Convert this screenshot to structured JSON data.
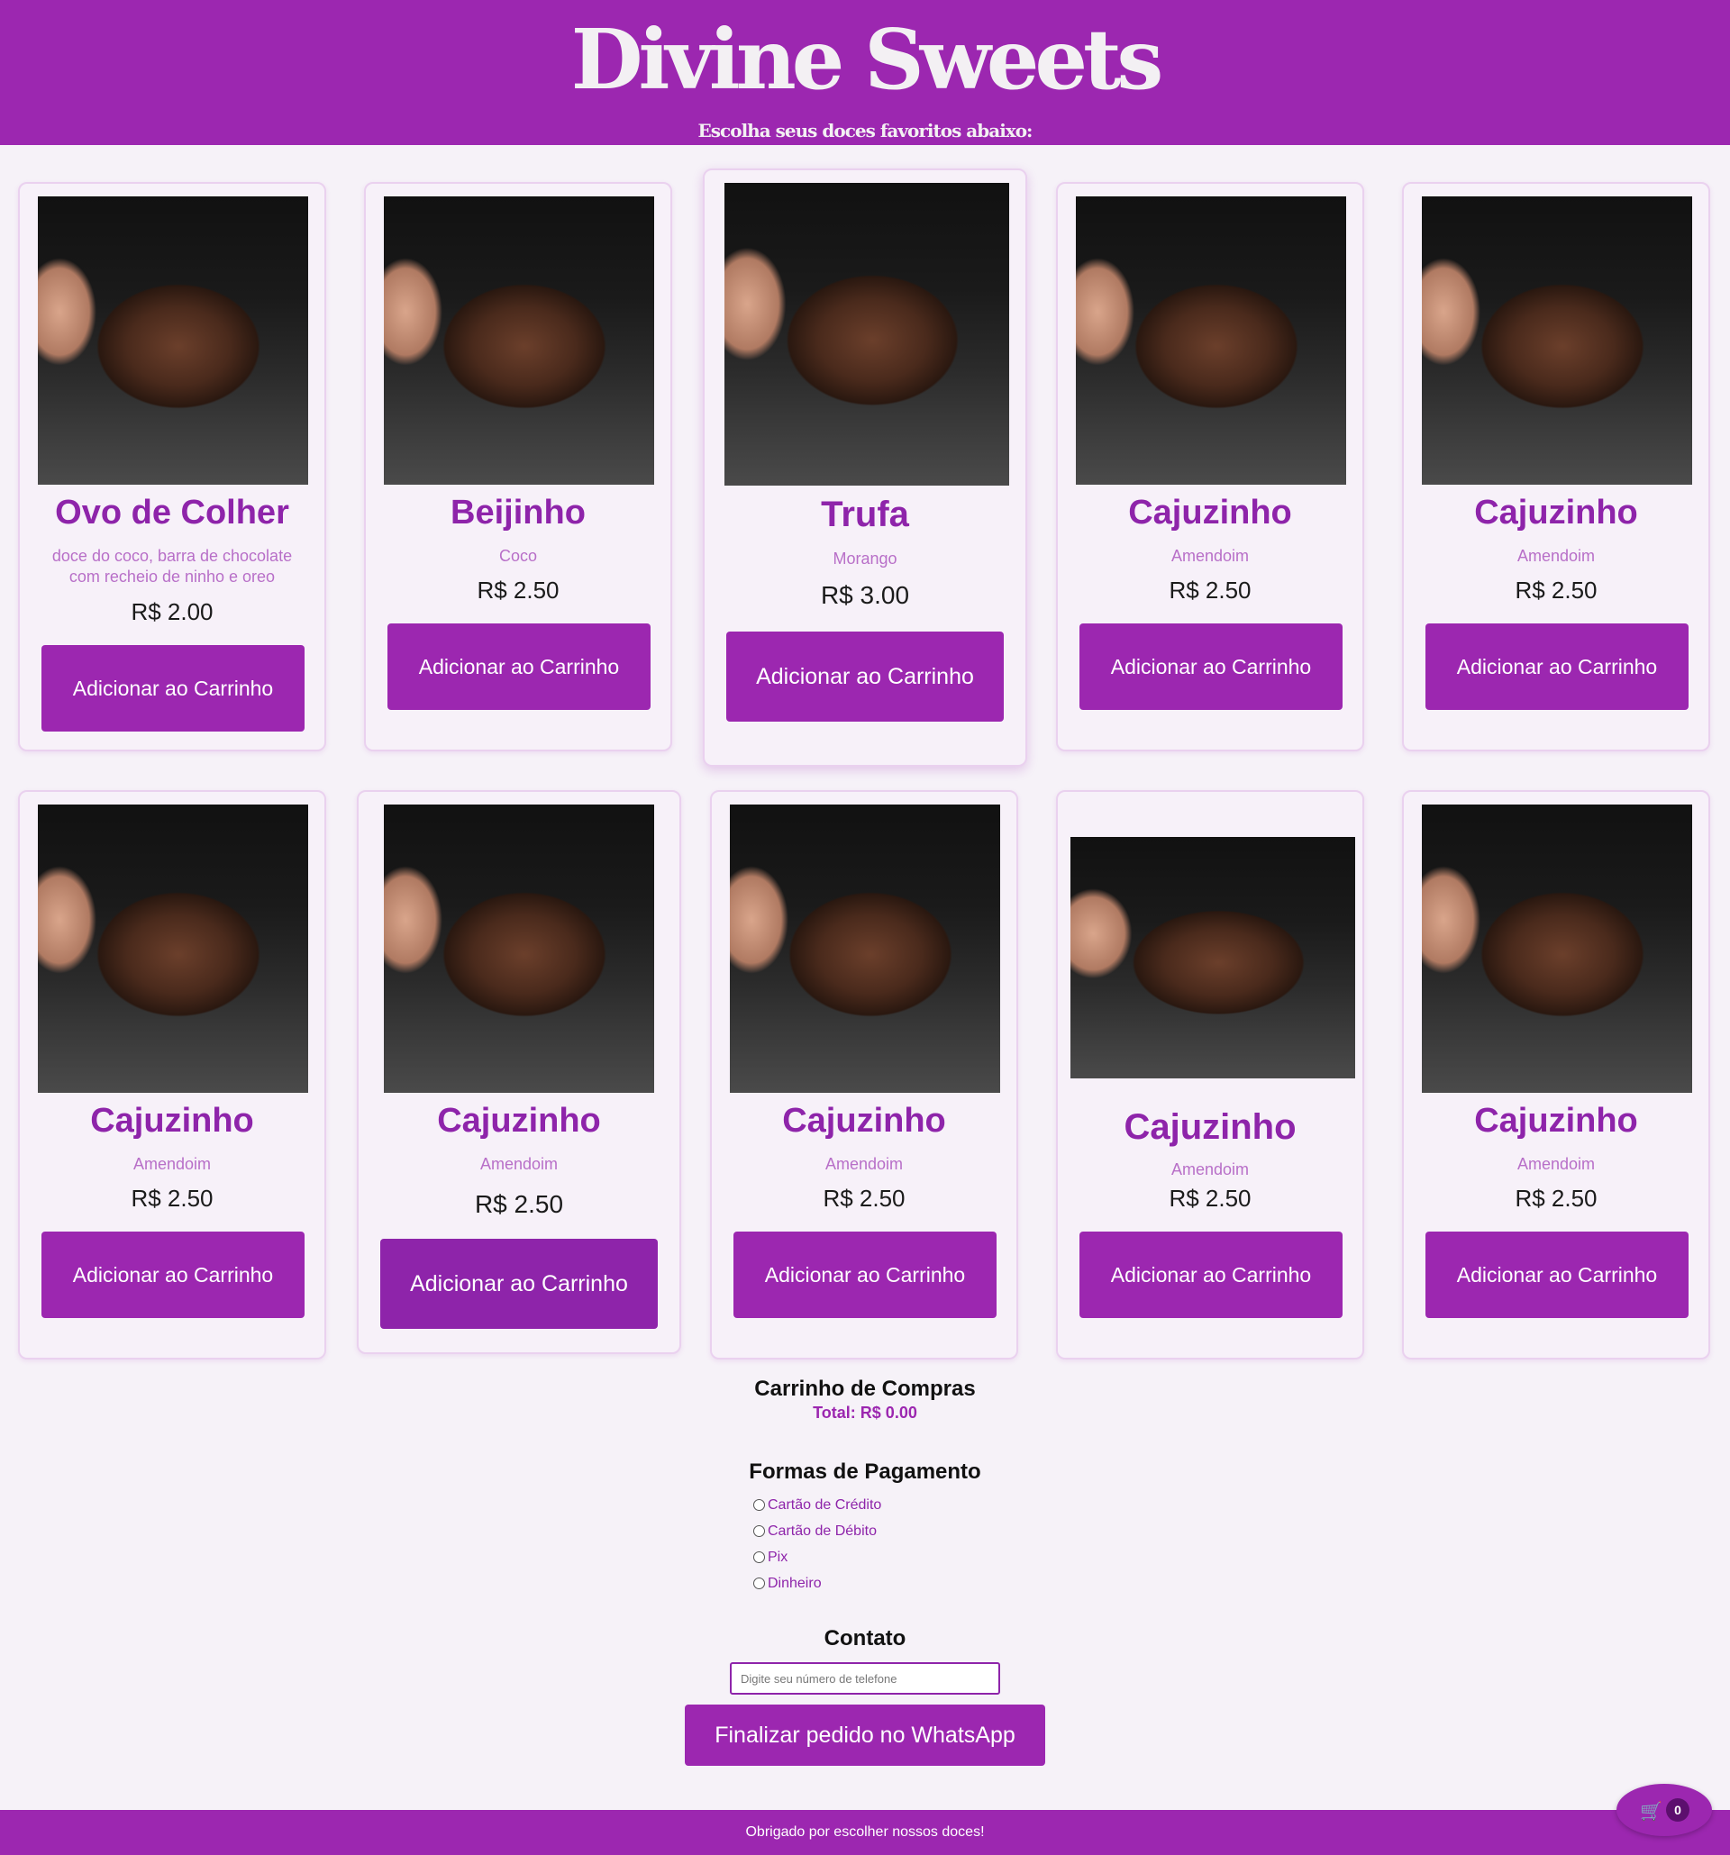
{
  "header": {
    "title": "Divine Sweets",
    "subtitle": "Escolha seus doces favoritos abaixo:"
  },
  "products": [
    {
      "name": "Ovo de Colher",
      "desc": "doce do coco, barra de chocolate com recheio de ninho e oreo",
      "price": "R$ 2.00",
      "button": "Adicionar ao Carrinho",
      "image": "chocolate-brownie-photo"
    },
    {
      "name": "Beijinho",
      "desc": "Coco",
      "price": "R$ 2.50",
      "button": "Adicionar ao Carrinho",
      "image": "chocolate-brownie-photo"
    },
    {
      "name": "Trufa",
      "desc": "Morango",
      "price": "R$ 3.00",
      "button": "Adicionar ao Carrinho",
      "image": "chocolate-brownie-photo"
    },
    {
      "name": "Cajuzinho",
      "desc": "Amendoim",
      "price": "R$ 2.50",
      "button": "Adicionar ao Carrinho",
      "image": "chocolate-brownie-photo"
    },
    {
      "name": "Cajuzinho",
      "desc": "Amendoim",
      "price": "R$ 2.50",
      "button": "Adicionar ao Carrinho",
      "image": "chocolate-brownie-photo"
    },
    {
      "name": "Cajuzinho",
      "desc": "Amendoim",
      "price": "R$ 2.50",
      "button": "Adicionar ao Carrinho",
      "image": "chocolate-brownie-photo"
    },
    {
      "name": "Cajuzinho",
      "desc": "Amendoim",
      "price": "R$ 2.50",
      "button": "Adicionar ao Carrinho",
      "image": "chocolate-brownie-photo"
    },
    {
      "name": "Cajuzinho",
      "desc": "Amendoim",
      "price": "R$ 2.50",
      "button": "Adicionar ao Carrinho",
      "image": "chocolate-brownie-photo"
    },
    {
      "name": "Cajuzinho",
      "desc": "Amendoim",
      "price": "R$ 2.50",
      "button": "Adicionar ao Carrinho",
      "image": "chocolate-brownie-photo"
    },
    {
      "name": "Cajuzinho",
      "desc": "Amendoim",
      "price": "R$ 2.50",
      "button": "Adicionar ao Carrinho",
      "image": "chocolate-brownie-photo"
    }
  ],
  "cart": {
    "title": "Carrinho de Compras",
    "total": "Total: R$ 0.00"
  },
  "payment": {
    "title": "Formas de Pagamento",
    "options": [
      "Cartão de Crédito",
      "Cartão de Débito",
      "Pix",
      "Dinheiro"
    ]
  },
  "contact": {
    "title": "Contato",
    "phone_placeholder": "Digite seu número de telefone",
    "submit_label": "Finalizar pedido no WhatsApp"
  },
  "footer": {
    "text": "Obrigado por escolher nossos doces!"
  },
  "cart_fab": {
    "icon": "cart-icon",
    "count": "0"
  },
  "colors": {
    "brand": "#9c27b0",
    "background": "#f6f2f8",
    "accent_text": "#8e24aa"
  }
}
